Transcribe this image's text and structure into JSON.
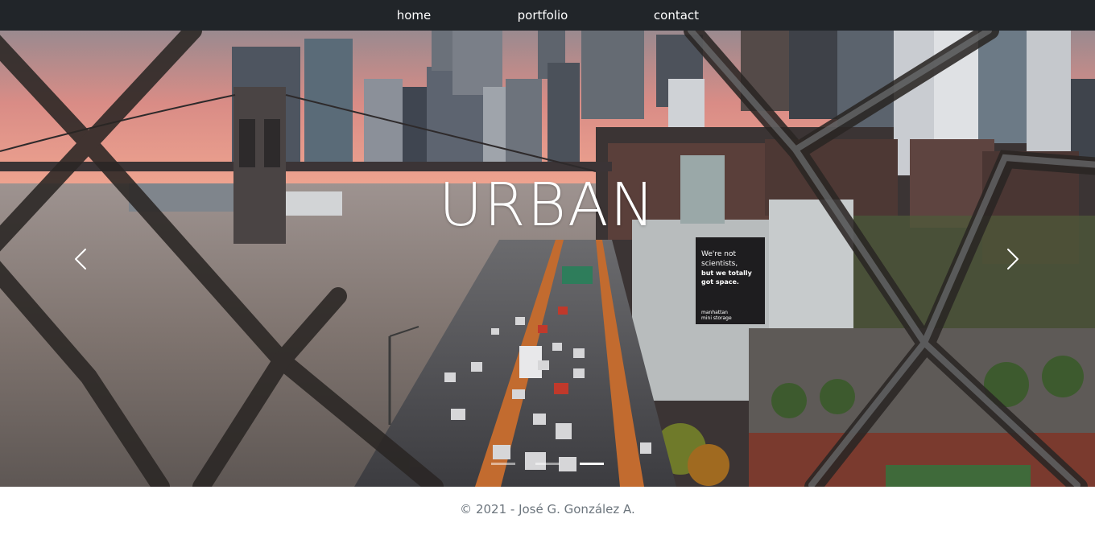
{
  "nav": {
    "items": [
      {
        "label": "home"
      },
      {
        "label": "portfolio"
      },
      {
        "label": "contact"
      }
    ]
  },
  "carousel": {
    "caption": "URBAN",
    "billboard": {
      "line1": "We're not",
      "line2": "scientists,",
      "line3": "but we totally",
      "line4": "got space.",
      "brand1": "manhattan",
      "brand2": "mini storage"
    },
    "prev_icon": "chevron-left-icon",
    "next_icon": "chevron-right-icon",
    "slide_count": 3,
    "active_slide": 2
  },
  "footer": {
    "copyright": "© 2021 - José G. González A."
  },
  "colors": {
    "navbar": "#212529",
    "footer_text": "#6c757d",
    "sky": "#e7857a"
  }
}
